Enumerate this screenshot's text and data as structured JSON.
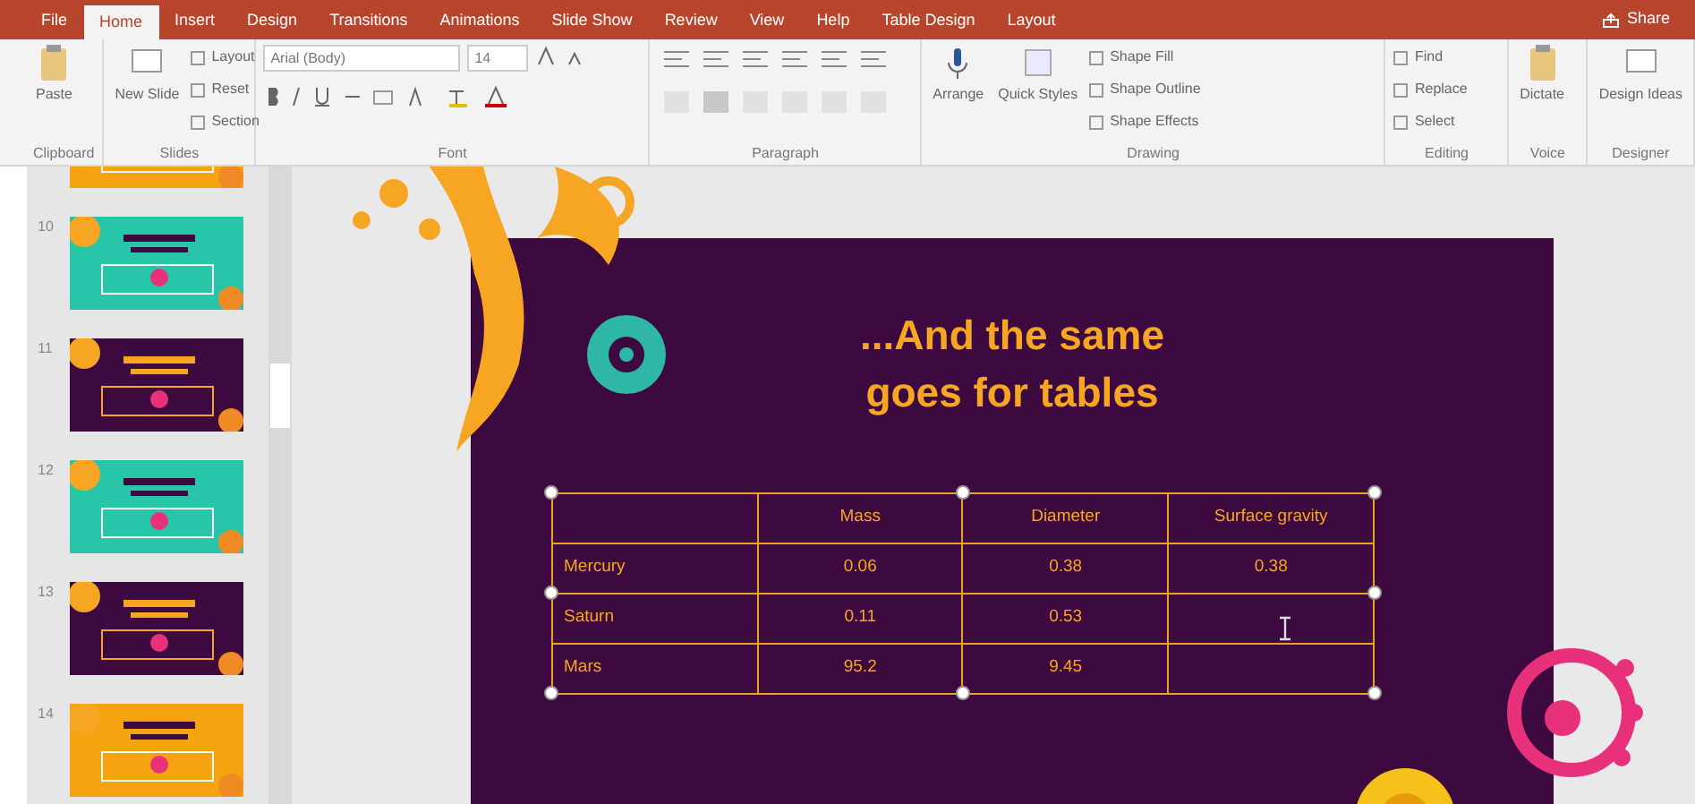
{
  "ribbon_tabs": [
    {
      "label": "File",
      "selected": false
    },
    {
      "label": "Home",
      "selected": true
    },
    {
      "label": "Insert",
      "selected": false
    },
    {
      "label": "Design",
      "selected": false
    },
    {
      "label": "Transitions",
      "selected": false
    },
    {
      "label": "Animations",
      "selected": false
    },
    {
      "label": "Slide Show",
      "selected": false
    },
    {
      "label": "Review",
      "selected": false
    },
    {
      "label": "View",
      "selected": false
    },
    {
      "label": "Help",
      "selected": false
    },
    {
      "label": "Table Design",
      "selected": false
    },
    {
      "label": "Layout",
      "selected": false
    }
  ],
  "share": "Share",
  "ribbon_groups": [
    {
      "kind": "buttons",
      "name": "Clipboard",
      "large": [
        "Paste"
      ]
    },
    {
      "kind": "buttons",
      "name": "Slides",
      "large": [
        "New Slide"
      ],
      "small": [
        "Layout",
        "Reset",
        "Section"
      ]
    },
    {
      "kind": "font",
      "name": "Font",
      "font": "Arial (Body)",
      "size": "14"
    },
    {
      "kind": "paragraph",
      "name": "Paragraph"
    },
    {
      "kind": "buttons",
      "name": "Drawing",
      "large": [
        "Arrange",
        "Quick Styles"
      ],
      "small": [
        "Shape Fill",
        "Shape Outline",
        "Shape Effects"
      ]
    },
    {
      "kind": "buttons",
      "name": "Editing",
      "small": [
        "Find",
        "Replace",
        "Select"
      ]
    },
    {
      "kind": "buttons",
      "name": "Voice",
      "large": [
        "Dictate"
      ]
    },
    {
      "kind": "buttons",
      "name": "Designer",
      "large": [
        "Design Ideas"
      ]
    }
  ],
  "thumbnails": [
    {
      "color": "#f5a40f"
    },
    {
      "number": "10",
      "color": "#27c6a8"
    },
    {
      "number": "11",
      "color": "#3d0a3f"
    },
    {
      "number": "12",
      "color": "#27c6a8"
    },
    {
      "number": "13",
      "color": "#3d0a3f"
    },
    {
      "number": "14",
      "color": "#f5a40f"
    }
  ],
  "slide": {
    "title": "...And the same goes for tables",
    "table": {
      "columns": [
        "",
        "Mass",
        "Diameter",
        "Surface gravity"
      ],
      "rows": [
        [
          "Mercury",
          "0.06",
          "0.38",
          "0.38"
        ],
        [
          "Saturn",
          "0.11",
          "0.53",
          ""
        ],
        [
          "Mars",
          "95.2",
          "9.45",
          ""
        ]
      ]
    }
  }
}
